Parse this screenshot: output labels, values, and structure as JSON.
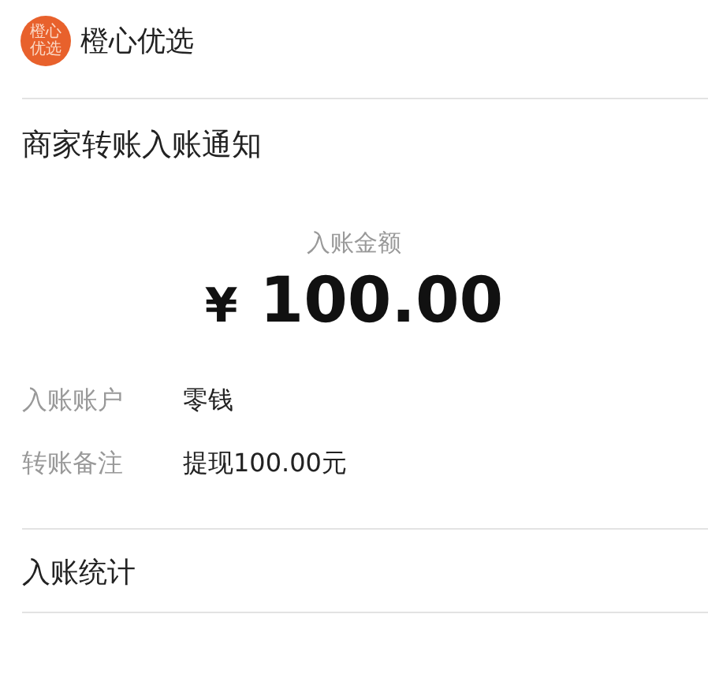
{
  "header": {
    "logo_text": [
      "橙心",
      "优选"
    ],
    "name": "橙心优选"
  },
  "notice": {
    "title": "商家转账入账通知",
    "amount_label": "入账金额",
    "currency": "¥",
    "amount": "100.00",
    "details": [
      {
        "label": "入账账户",
        "value": "零钱"
      },
      {
        "label": "转账备注",
        "value": "提现100.00元"
      }
    ]
  },
  "footer": {
    "label": "入账统计"
  }
}
